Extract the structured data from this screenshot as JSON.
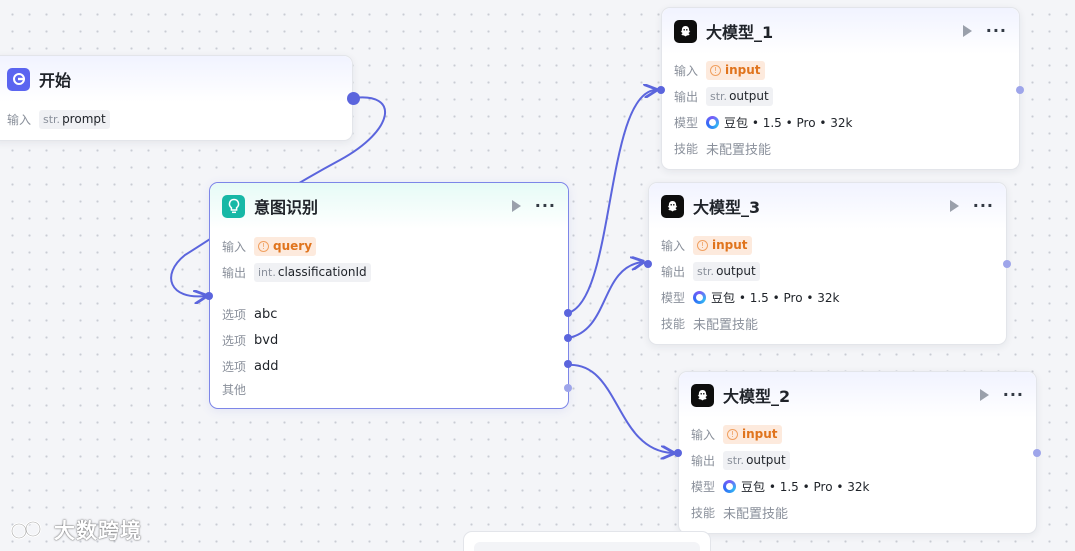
{
  "colors": {
    "accent": "#5b65dd",
    "intent_icon": "#17b8a6",
    "start_icon": "#5b65f0",
    "warning": "#e0741d"
  },
  "nodes": {
    "start": {
      "title": "开始",
      "icon": "start-icon",
      "input_label": "输入",
      "input_type": "str.",
      "input_name": "prompt"
    },
    "intent": {
      "title": "意图识别",
      "icon": "lightbulb-icon",
      "input_label": "输入",
      "input_name": "query",
      "output_label": "输出",
      "output_type": "int.",
      "output_name": "classificationId",
      "options": [
        {
          "label": "选项",
          "value": "abc"
        },
        {
          "label": "选项",
          "value": "bvd"
        },
        {
          "label": "选项",
          "value": "add"
        }
      ],
      "other_label": "其他"
    },
    "llm_1": {
      "title": "大模型_1",
      "icon": "llm-logo-icon",
      "input_label": "输入",
      "input_name": "input",
      "output_label": "输出",
      "output_type": "str.",
      "output_name": "output",
      "model_label": "模型",
      "model_value": "豆包 • 1.5 • Pro • 32k",
      "skill_label": "技能",
      "skill_value": "未配置技能"
    },
    "llm_3": {
      "title": "大模型_3",
      "icon": "llm-logo-icon",
      "input_label": "输入",
      "input_name": "input",
      "output_label": "输出",
      "output_type": "str.",
      "output_name": "output",
      "model_label": "模型",
      "model_value": "豆包 • 1.5 • Pro • 32k",
      "skill_label": "技能",
      "skill_value": "未配置技能"
    },
    "llm_2": {
      "title": "大模型_2",
      "icon": "llm-logo-icon",
      "input_label": "输入",
      "input_name": "input",
      "output_label": "输出",
      "output_type": "str.",
      "output_name": "output",
      "model_label": "模型",
      "model_value": "豆包 • 1.5 • Pro • 32k",
      "skill_label": "技能",
      "skill_value": "未配置技能"
    }
  },
  "watermark": {
    "text": "大数跨境"
  }
}
